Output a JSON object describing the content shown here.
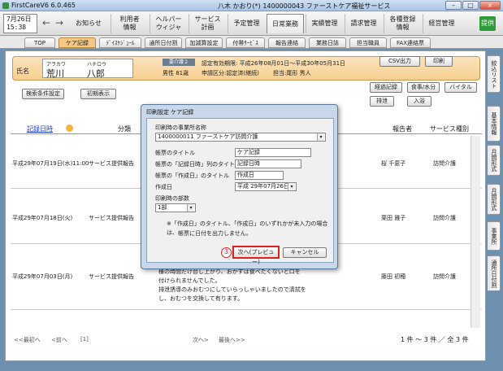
{
  "window": {
    "app_title": "FirstCareV6 6.0.465",
    "user_title": "八木 かおり(*) 1400000043 ファーストケア福祉サービス",
    "btn_min": "–",
    "btn_max": "□",
    "btn_close": "×"
  },
  "toolbar": {
    "date": "7月26日",
    "time": "15:38",
    "back_glyph": "←",
    "forward_glyph": "→",
    "items": [
      "お知らせ",
      "利用者\n情報",
      "ヘルパー\nウィジャ",
      "サービス\n計画",
      "予定管理",
      "日常業務",
      "実績管理",
      "請求管理",
      "各種登録\n情報",
      "経営管理"
    ],
    "help": "提供"
  },
  "subtabs": [
    "TOP",
    "ケア記録",
    "ﾃﾞｲｽｹｼﾞｭｰﾙ",
    "通所日付割",
    "加減算設定",
    "付帯ｻｰﾋﾞｽ",
    "報告連絡",
    "業務日誌",
    "担当職員",
    "FAX連絡票"
  ],
  "client": {
    "furigana_family": "アラカワ",
    "furigana_given": "ハチロウ",
    "name_label": "氏名",
    "family": "荒川",
    "given": "八郎",
    "status_tag": "要介護２",
    "sex_age": "男性 81歳",
    "cert_period": "認定有効期限: 平成26年08月01日～平成30年05月31日",
    "apply": "申請区分:認定済(継続)",
    "staff": "担当:尾形 秀人"
  },
  "buttons": {
    "search_cond": "検索条件設定",
    "init_display": "初期表示",
    "csv": "CSV出力",
    "print": "印刷",
    "progress": "経過記録",
    "meal": "食事/水分",
    "vital": "バイタル",
    "excretion": "排泄",
    "bath": "入浴"
  },
  "sidetabs": [
    "絞込リスト",
    "基本情報",
    "月間形式",
    "月間形式",
    "事業所",
    "通所日付割"
  ],
  "table": {
    "headers": {
      "date": "記録日時",
      "category": "分類",
      "reporter": "報告者",
      "service": "サービス種別"
    },
    "rows": [
      {
        "date": "平成29年07月19日(水)11:00",
        "category": "サービス提供報告",
        "reporter": "桜 千恵子",
        "service": "訪問介護"
      },
      {
        "date": "平成29年07月18日(火)",
        "category": "サービス提供報告",
        "reporter": "栗田 雅子",
        "service": "訪問介護"
      },
      {
        "date": "平成29年07月03日(月)",
        "category": "サービス提供報告",
        "reporter": "藤田 初穂",
        "service": "訪問介護"
      }
    ],
    "row3_text": [
      "様の時間だけ台し上がり、おかずは食べたくないと口を",
      "付けられませんでした。",
      "排泄誘導のみおむつにしていらっしゃいましたので清拭を",
      "し、おむつを交換して有ります。"
    ]
  },
  "footer": {
    "first": "<<最初へ",
    "prev": "<前へ",
    "page": "[1]",
    "next": "次へ>",
    "last": "最後へ>>",
    "count": "1 件 ～ 3 件 ／ 全 3 件"
  },
  "dialog": {
    "title": "印刷設定  ケア記録",
    "office_label": "印刷時の事業所名称",
    "office_value": "1400000011 ファーストケア訪問介護",
    "form_title_label": "帳票のタイトル",
    "form_title_value": "ケア記録",
    "date_col_label": "帳票の「記録日時」列のタイトル",
    "date_col_value": "記録日時",
    "created_title_label": "帳票の「作成日」のタイトル",
    "created_title_value": "作成日",
    "created_label": "作成日",
    "created_value": "平成 29年07月26日",
    "copies_label": "印刷時の部数",
    "copies_value": "1部",
    "note_line1": "※「作成日」のタイトル、「作成日」のいずれかが未入力の場合は、",
    "note_line2": "帳票に日付を出力しません。",
    "step_number": "3",
    "next_button": "次へ(プレビュー)",
    "cancel_button": "キャンセル",
    "caret": "▾"
  }
}
